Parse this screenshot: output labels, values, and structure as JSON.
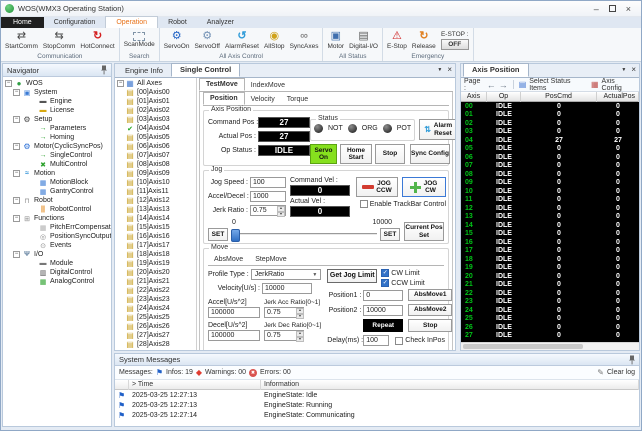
{
  "window": {
    "title": "WOS(WMX3 Operating Station)"
  },
  "colors": {
    "accent_orange": "#e8731a",
    "servo_on_green": "#86e01e",
    "axis_number_green": "#00c317",
    "estop_red": "#d02020",
    "field_black": "#000000"
  },
  "ribbon": {
    "tabs": [
      "Home",
      "Configuration",
      "Operation",
      "Robot",
      "Analyzer"
    ],
    "active_tab": "Operation",
    "buttons": {
      "startcomm": "StartComm",
      "stopcomm": "StopComm",
      "hotconnect": "HotConnect",
      "scanmode": "ScanMode",
      "servoon": "ServoOn",
      "servooff": "ServoOff",
      "alarmreset": "AlarmReset",
      "allstop": "AllStop",
      "syncaxes": "SyncAxes",
      "motor": "Motor",
      "digitalio": "Digital-I/O",
      "estop": "E-Stop",
      "release": "Release"
    },
    "group_labels": {
      "communication": "Communication",
      "search": "Search",
      "all_axis_control": "All Axis Control",
      "all_status": "All Status",
      "emergency": "Emergency"
    },
    "estop_label": "E-STOP :",
    "estop_state": "OFF"
  },
  "navigator": {
    "title": "Navigator",
    "items": [
      {
        "label": "WOS",
        "level": 0,
        "icon": "wos",
        "exp": true
      },
      {
        "label": "System",
        "level": 1,
        "icon": "system",
        "exp": true
      },
      {
        "label": "Engine",
        "level": 2,
        "icon": "engine",
        "exp": false
      },
      {
        "label": "License",
        "level": 2,
        "icon": "license",
        "exp": false
      },
      {
        "label": "Setup",
        "level": 1,
        "icon": "setup",
        "exp": true
      },
      {
        "label": "Parameters",
        "level": 2,
        "icon": "garrow",
        "exp": false
      },
      {
        "label": "Homing",
        "level": 2,
        "icon": "garrow",
        "exp": false
      },
      {
        "label": "Motor(CyclicSyncPos)",
        "level": 1,
        "icon": "motorgrp",
        "exp": true
      },
      {
        "label": "SingleControl",
        "level": 2,
        "icon": "garrow",
        "exp": false
      },
      {
        "label": "MultiControl",
        "level": 2,
        "icon": "multi",
        "exp": false
      },
      {
        "label": "Motion",
        "level": 1,
        "icon": "motion",
        "exp": true
      },
      {
        "label": "MotionBlock",
        "level": 2,
        "icon": "mblock",
        "exp": false
      },
      {
        "label": "GantryControl",
        "level": 2,
        "icon": "mblock",
        "exp": false
      },
      {
        "label": "Robot",
        "level": 1,
        "icon": "robot",
        "exp": true
      },
      {
        "label": "RobotControl",
        "level": 2,
        "icon": "robotctl",
        "exp": false
      },
      {
        "label": "Functions",
        "level": 1,
        "icon": "functions",
        "exp": true
      },
      {
        "label": "PitchErrCompensation",
        "level": 2,
        "icon": "pitch",
        "exp": false
      },
      {
        "label": "PositionSyncOutput",
        "level": 2,
        "icon": "possync",
        "exp": false
      },
      {
        "label": "Events",
        "level": 2,
        "icon": "events",
        "exp": false
      },
      {
        "label": "I/O",
        "level": 1,
        "icon": "io",
        "exp": true
      },
      {
        "label": "Module",
        "level": 2,
        "icon": "module",
        "exp": false
      },
      {
        "label": "DigitalControl",
        "level": 2,
        "icon": "digital",
        "exp": false
      },
      {
        "label": "AnalogControl",
        "level": 2,
        "icon": "analog",
        "exp": false
      }
    ]
  },
  "center": {
    "tabs": [
      "Engine Info",
      "Single Control"
    ],
    "active_tab": "Single Control"
  },
  "axis_list": {
    "items": [
      {
        "label": "All Axes",
        "icon": "all",
        "exp": true
      },
      {
        "label": "[00]Axis00",
        "icon": "axis",
        "exp": false
      },
      {
        "label": "[01]Axis01",
        "icon": "axis",
        "exp": false
      },
      {
        "label": "[02]Axis02",
        "icon": "axis",
        "exp": false
      },
      {
        "label": "[03]Axis03",
        "icon": "axis",
        "exp": false
      },
      {
        "label": "[04]Axis04",
        "icon": "check",
        "exp": false
      },
      {
        "label": "[05]Axis05",
        "icon": "axis",
        "exp": false
      },
      {
        "label": "[06]Axis06",
        "icon": "axis",
        "exp": false
      },
      {
        "label": "[07]Axis07",
        "icon": "axis",
        "exp": false
      },
      {
        "label": "[08]Axis08",
        "icon": "axis",
        "exp": false
      },
      {
        "label": "[09]Axis09",
        "icon": "axis",
        "exp": false
      },
      {
        "label": "[10]Axis10",
        "icon": "axis",
        "exp": false
      },
      {
        "label": "[11]Axis11",
        "icon": "axis",
        "exp": false
      },
      {
        "label": "[12]Axis12",
        "icon": "axis",
        "exp": false
      },
      {
        "label": "[13]Axis13",
        "icon": "axis",
        "exp": false
      },
      {
        "label": "[14]Axis14",
        "icon": "axis",
        "exp": false
      },
      {
        "label": "[15]Axis15",
        "icon": "axis",
        "exp": false
      },
      {
        "label": "[16]Axis16",
        "icon": "axis",
        "exp": false
      },
      {
        "label": "[17]Axis17",
        "icon": "axis",
        "exp": false
      },
      {
        "label": "[18]Axis18",
        "icon": "axis",
        "exp": false
      },
      {
        "label": "[19]Axis19",
        "icon": "axis",
        "exp": false
      },
      {
        "label": "[20]Axis20",
        "icon": "axis",
        "exp": false
      },
      {
        "label": "[21]Axis21",
        "icon": "axis",
        "exp": false
      },
      {
        "label": "[22]Axis22",
        "icon": "axis",
        "exp": false
      },
      {
        "label": "[23]Axis23",
        "icon": "axis",
        "exp": false
      },
      {
        "label": "[24]Axis24",
        "icon": "axis",
        "exp": false
      },
      {
        "label": "[25]Axis25",
        "icon": "axis",
        "exp": false
      },
      {
        "label": "[26]Axis26",
        "icon": "axis",
        "exp": false
      },
      {
        "label": "[27]Axis27",
        "icon": "axis",
        "exp": false
      },
      {
        "label": "[28]Axis28",
        "icon": "axis",
        "exp": false
      }
    ]
  },
  "testmove": {
    "tabs": [
      "TestMove",
      "IndexMove"
    ],
    "mode_tabs": [
      "Position",
      "Velocity",
      "Torque"
    ],
    "axis_position": {
      "title": "Axis Position",
      "command_pos_label": "Command Pos :",
      "command_pos": "27",
      "actual_pos_label": "Actual Pos :",
      "actual_pos": "27",
      "op_status_label": "Op Status :",
      "op_status": "IDLE",
      "status_title": "Status",
      "indicators": [
        "NOT",
        "ORG",
        "POT"
      ],
      "alarm_reset": "Alarm Reset",
      "servo_on": "Servo On",
      "home_start": "Home Start",
      "stop": "Stop",
      "sync_config": "Sync Config"
    },
    "jog": {
      "title": "Jog",
      "jog_speed_label": "Jog Speed :",
      "jog_speed": "100",
      "accel_decel_label": "Accel/Decel :",
      "accel_decel": "1000",
      "jerk_ratio_label": "Jerk Ratio :",
      "jerk_ratio": "0.75",
      "command_vel_label": "Command Vel :",
      "command_vel": "0",
      "actual_vel_label": "Actual Vel :",
      "actual_vel": "0",
      "jog_ccw": "JOG CCW",
      "jog_cw": "JOG CW",
      "enable_trackbar": "Enable TrackBar Control",
      "slider_min": "0",
      "slider_max": "10000",
      "set_left": "SET",
      "set_right": "SET",
      "current_pos_set": "Current Pos Set"
    },
    "move": {
      "title": "Move",
      "tabs": [
        "AbsMove",
        "StepMove"
      ],
      "profile_type_label": "Profile Type :",
      "profile_type": "JerkRatio",
      "velocity_label": "Velocity[U/s] :",
      "velocity": "10000",
      "accel_label": "Accel[U/s^2]",
      "accel": "100000",
      "jerk_acc_label": "Jerk Acc Ratio[0~1]",
      "jerk_acc": "0.75",
      "decel_label": "Decel[U/s^2]",
      "decel": "100000",
      "jerk_dec_label": "Jerk Dec Ratio[0~1]",
      "jerk_dec": "0.75",
      "get_jog_limit": "Get Jog Limit",
      "cw_limit": "CW Limit",
      "ccw_limit": "CCW Limit",
      "position1_label": "Position1 :",
      "position1": "0",
      "absmove1": "AbsMove1",
      "position2_label": "Position2 :",
      "position2": "10000",
      "absmove2": "AbsMove2",
      "repeat": "Repeat",
      "stop": "Stop",
      "delay_label": "Delay(ms) :",
      "delay": "100",
      "check_inpos": "Check InPos"
    }
  },
  "axis_panel": {
    "tab": "Axis Position",
    "page_label": "Page :",
    "select_status_items": "Select Status Items",
    "axis_config": "Axis Config",
    "columns": [
      "Axis",
      "Op",
      "PosCmd",
      "ActualPos"
    ],
    "rows": [
      {
        "axis": "00",
        "op": "IDLE",
        "cmd": "0",
        "act": "0"
      },
      {
        "axis": "01",
        "op": "IDLE",
        "cmd": "0",
        "act": "0"
      },
      {
        "axis": "02",
        "op": "IDLE",
        "cmd": "0",
        "act": "0"
      },
      {
        "axis": "03",
        "op": "IDLE",
        "cmd": "0",
        "act": "0"
      },
      {
        "axis": "04",
        "op": "IDLE",
        "cmd": "27",
        "act": "27"
      },
      {
        "axis": "05",
        "op": "IDLE",
        "cmd": "0",
        "act": "0"
      },
      {
        "axis": "06",
        "op": "IDLE",
        "cmd": "0",
        "act": "0"
      },
      {
        "axis": "07",
        "op": "IDLE",
        "cmd": "0",
        "act": "0"
      },
      {
        "axis": "08",
        "op": "IDLE",
        "cmd": "0",
        "act": "0"
      },
      {
        "axis": "09",
        "op": "IDLE",
        "cmd": "0",
        "act": "0"
      },
      {
        "axis": "10",
        "op": "IDLE",
        "cmd": "0",
        "act": "0"
      },
      {
        "axis": "11",
        "op": "IDLE",
        "cmd": "0",
        "act": "0"
      },
      {
        "axis": "12",
        "op": "IDLE",
        "cmd": "0",
        "act": "0"
      },
      {
        "axis": "13",
        "op": "IDLE",
        "cmd": "0",
        "act": "0"
      },
      {
        "axis": "14",
        "op": "IDLE",
        "cmd": "0",
        "act": "0"
      },
      {
        "axis": "15",
        "op": "IDLE",
        "cmd": "0",
        "act": "0"
      },
      {
        "axis": "16",
        "op": "IDLE",
        "cmd": "0",
        "act": "0"
      },
      {
        "axis": "17",
        "op": "IDLE",
        "cmd": "0",
        "act": "0"
      },
      {
        "axis": "18",
        "op": "IDLE",
        "cmd": "0",
        "act": "0"
      },
      {
        "axis": "19",
        "op": "IDLE",
        "cmd": "0",
        "act": "0"
      },
      {
        "axis": "20",
        "op": "IDLE",
        "cmd": "0",
        "act": "0"
      },
      {
        "axis": "21",
        "op": "IDLE",
        "cmd": "0",
        "act": "0"
      },
      {
        "axis": "22",
        "op": "IDLE",
        "cmd": "0",
        "act": "0"
      },
      {
        "axis": "23",
        "op": "IDLE",
        "cmd": "0",
        "act": "0"
      },
      {
        "axis": "24",
        "op": "IDLE",
        "cmd": "0",
        "act": "0"
      },
      {
        "axis": "25",
        "op": "IDLE",
        "cmd": "0",
        "act": "0"
      },
      {
        "axis": "26",
        "op": "IDLE",
        "cmd": "0",
        "act": "0"
      },
      {
        "axis": "27",
        "op": "IDLE",
        "cmd": "0",
        "act": "0"
      }
    ]
  },
  "messages": {
    "title": "System Messages",
    "messages_label": "Messages:",
    "infos_label": "Infos: 19",
    "warnings_label": "Warnings: 00",
    "errors_label": "Errors: 00",
    "clear_log": "Clear log",
    "col_time": "> Time",
    "col_info": "Information",
    "rows": [
      {
        "time": "2025-03-25 12:27:13",
        "info": "EngineState: Idle"
      },
      {
        "time": "2025-03-25 12:27:13",
        "info": "EngineState: Running"
      },
      {
        "time": "2025-03-25 12:27:14",
        "info": "EngineState: Communicating"
      }
    ]
  }
}
